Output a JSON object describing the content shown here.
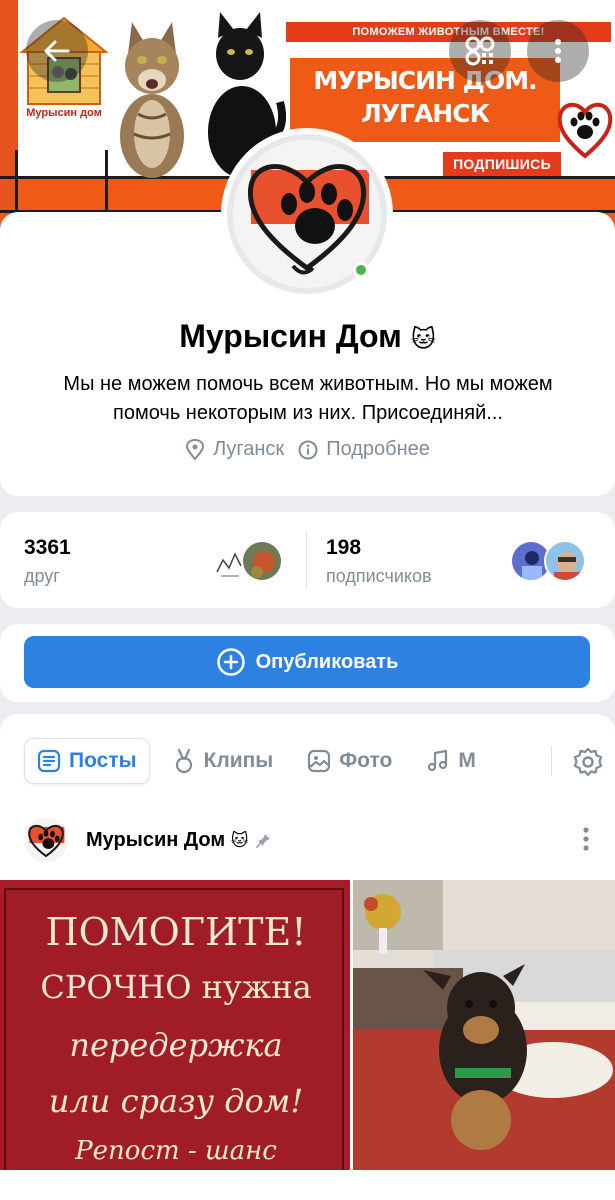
{
  "cover": {
    "banner_top": "ПОМОЖЕМ ЖИВОТНЫМ ВМЕСТЕ!",
    "title_line1": "МУРЫСИН ДОМ.",
    "title_line2": "ЛУГАНСК",
    "subscribe": "ПОДПИШИСЬ",
    "house_label": "Мурысин дом",
    "colors": {
      "orange": "#ef5a16",
      "red": "#e53b1b"
    }
  },
  "header": {
    "back_icon": "arrow-left-icon",
    "qr_icon": "qr-code-icon",
    "more_icon": "more-vertical-icon"
  },
  "profile": {
    "name": "Мурысин Дом",
    "name_emoji": "🐱",
    "description": "Мы не можем помочь всем животным. Но мы можем помочь некоторым из них. Присоединяй...",
    "location": "Луганск",
    "more_info": "Подробнее",
    "online": true
  },
  "stats": {
    "friends_count": "3361",
    "friends_label": "друг",
    "followers_count": "198",
    "followers_label": "подписчиков"
  },
  "publish": {
    "label": "Опубликовать"
  },
  "tabs": [
    {
      "label": "Посты",
      "icon": "posts-icon",
      "active": true
    },
    {
      "label": "Клипы",
      "icon": "clips-icon",
      "active": false
    },
    {
      "label": "Фото",
      "icon": "photo-icon",
      "active": false
    },
    {
      "label": "М",
      "icon": "music-icon",
      "active": false
    }
  ],
  "post": {
    "author": "Мурысин Дом",
    "author_emoji": "🐱",
    "pinned": true,
    "poster_lines": [
      "ПОМОГИТЕ!",
      "СРОЧНО нужна",
      "передержка",
      "или сразу дом!",
      "Репост - шанс"
    ],
    "accent": "#2d81e0"
  }
}
